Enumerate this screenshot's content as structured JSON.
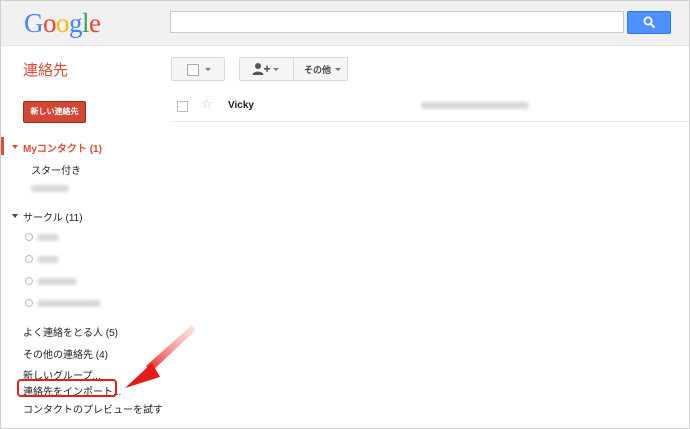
{
  "logo": {
    "letters": [
      "G",
      "o",
      "o",
      "g",
      "l",
      "e"
    ],
    "colors": [
      "#4285f4",
      "#ea4335",
      "#fbbc05",
      "#4285f4",
      "#34a853",
      "#ea4335"
    ]
  },
  "search": {
    "placeholder": "",
    "icon": "search-icon"
  },
  "app": {
    "title": "連絡先"
  },
  "toolbar": {
    "more_label": "その他"
  },
  "buttons": {
    "new_contact": "新しい連絡先"
  },
  "sidebar": {
    "my_contacts": {
      "label": "Myコンタクト",
      "count": "(1)"
    },
    "starred": "スター付き",
    "circles": {
      "label": "サークル",
      "count": "(11)"
    },
    "most_contacted": {
      "label": "よく連絡をとる人",
      "count": "(5)"
    },
    "other_contacts": {
      "label": "その他の連絡先",
      "count": "(4)"
    },
    "new_group": "新しいグループ...",
    "import": "連絡先をインポート...",
    "preview": "コンタクトのプレビューを試す"
  },
  "contacts": [
    {
      "name": "Vicky"
    }
  ],
  "colors": {
    "accent": "#dd4b39",
    "search_button": "#4d90fe",
    "annotation": "#e22020"
  }
}
